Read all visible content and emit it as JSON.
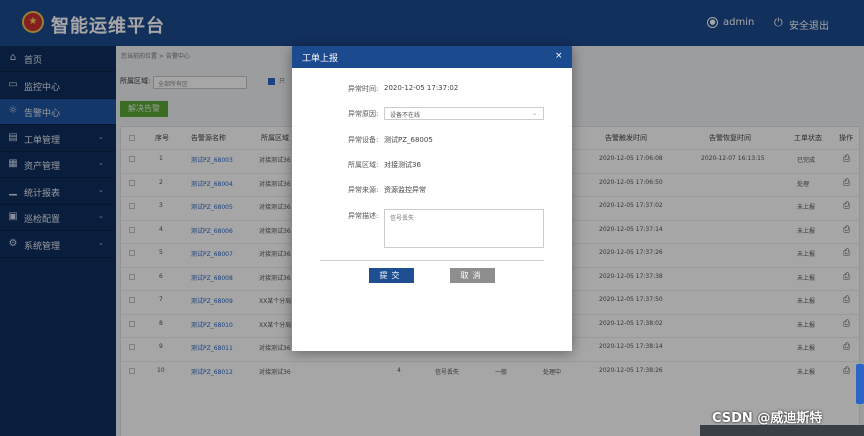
{
  "header": {
    "title": "智能运维平台",
    "username": "admin",
    "logout_label": "安全退出",
    "logo_glyph": "★"
  },
  "sidebar": {
    "items": [
      {
        "label": "首页",
        "icon": "home-icon",
        "glyph": "⌂",
        "has_arrow": false
      },
      {
        "label": "监控中心",
        "icon": "monitor-icon",
        "glyph": "▭",
        "has_arrow": false
      },
      {
        "label": "告警中心",
        "icon": "alarm-icon",
        "glyph": "☼",
        "has_arrow": false
      },
      {
        "label": "工单管理",
        "icon": "ticket-icon",
        "glyph": "▤",
        "has_arrow": true
      },
      {
        "label": "资产管理",
        "icon": "asset-icon",
        "glyph": "▦",
        "has_arrow": true
      },
      {
        "label": "统计报表",
        "icon": "chart-icon",
        "glyph": "▁",
        "has_arrow": true
      },
      {
        "label": "巡检配置",
        "icon": "inspect-icon",
        "glyph": "▣",
        "has_arrow": true
      },
      {
        "label": "系统管理",
        "icon": "gear-icon",
        "glyph": "⚙",
        "has_arrow": true
      }
    ],
    "active_index": 2,
    "arrow_glyph": "⌄"
  },
  "content": {
    "breadcrumb": "您当前的位置 > 告警中心",
    "filter_label": "所属区域:",
    "filter_value": "全部所有区",
    "checkbox_label": "只",
    "resolve_button": "解决告警"
  },
  "table": {
    "headers": [
      "序号",
      "告警源名称",
      "所属区域",
      "告警触发时间",
      "告警恢复时间",
      "工单状态",
      "操作"
    ],
    "rows": [
      {
        "no": "1",
        "name": "测试PZ_68003",
        "area": "对接测试36",
        "trigger": "2020-12-05 17:06:08",
        "recover": "2020-12-07 16:13:15",
        "status": "已完成"
      },
      {
        "no": "2",
        "name": "测试PZ_68004",
        "area": "对接测试36",
        "trigger": "2020-12-05 17:06:50",
        "recover": "",
        "status": "处理"
      },
      {
        "no": "3",
        "name": "测试PZ_68005",
        "area": "对接测试36",
        "trigger": "2020-12-05 17:37:02",
        "recover": "",
        "status": "未上报"
      },
      {
        "no": "4",
        "name": "测试PZ_68006",
        "area": "对接测试36",
        "trigger": "2020-12-05 17:37:14",
        "recover": "",
        "status": "未上报"
      },
      {
        "no": "5",
        "name": "测试PZ_68007",
        "area": "对接测试36",
        "trigger": "2020-12-05 17:37:26",
        "recover": "",
        "status": "未上报"
      },
      {
        "no": "6",
        "name": "测试PZ_68008",
        "area": "对接测试36",
        "trigger": "2020-12-05 17:37:38",
        "recover": "",
        "status": "未上报"
      },
      {
        "no": "7",
        "name": "测试PZ_68009",
        "area": "XX某个分局",
        "trigger": "2020-12-05 17:37:50",
        "recover": "",
        "status": "未上报"
      },
      {
        "no": "8",
        "name": "测试PZ_68010",
        "area": "XX某个分局",
        "trigger": "2020-12-05 17:38:02",
        "recover": "",
        "status": "未上报"
      },
      {
        "no": "9",
        "name": "测试PZ_68011",
        "area": "对接测试36",
        "trigger": "2020-12-05 17:38:14",
        "recover": "",
        "status": "未上报"
      },
      {
        "no": "10",
        "name": "测试PZ_68012",
        "area": "对接测试36",
        "trigger": "2020-12-05 17:38:26",
        "recover": "",
        "status": "未上报"
      }
    ],
    "row10_extra": {
      "count": "4",
      "desc": "信号丢失",
      "level": "一般",
      "state": "处理中"
    },
    "action_glyph": "⎙"
  },
  "modal": {
    "title": "工单上报",
    "close": "×",
    "fields": {
      "time_label": "异常时间:",
      "time_value": "2020-12-05 17:37:02",
      "reason_label": "异常原因:",
      "reason_value": "设备不在线",
      "device_label": "异常设备:",
      "device_value": "测试PZ_68005",
      "area_label": "所属区域:",
      "area_value": "对接测试36",
      "source_label": "异常来源:",
      "source_value": "资源监控异常",
      "desc_label": "异常描述:",
      "desc_value": "信号丢失"
    },
    "submit_label": "提交",
    "cancel_label": "取消",
    "chevron": "⌄"
  },
  "watermark": "CSDN @威迪斯特"
}
